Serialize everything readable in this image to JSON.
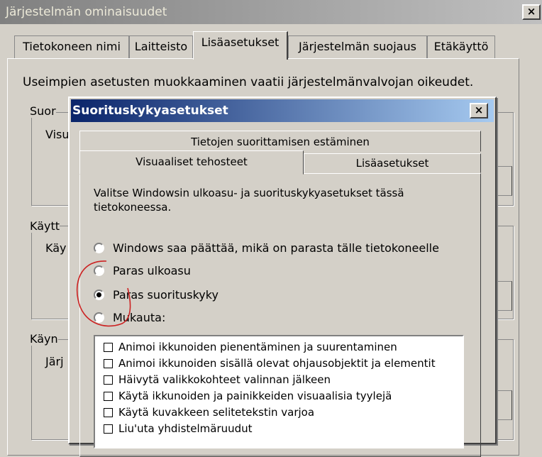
{
  "outer_window": {
    "title": "Järjestelmän ominaisuudet",
    "close_label": "×",
    "tabs": [
      {
        "label": "Tietokoneen nimi"
      },
      {
        "label": "Laitteisto"
      },
      {
        "label": "Lisäasetukset",
        "active": true
      },
      {
        "label": "Järjestelmän suojaus"
      },
      {
        "label": "Etäkäyttö"
      }
    ],
    "admin_note": "Useimpien asetusten muokkaaminen vaatii järjestelmänvalvojan oikeudet.",
    "groups": [
      {
        "label": "Suor",
        "sub": "Visu"
      },
      {
        "label": "Käytt",
        "sub": "Käy"
      },
      {
        "label": "Käyn",
        "sub": "Järj"
      }
    ]
  },
  "inner_dialog": {
    "title": "Suorituskykyasetukset",
    "close_label": "×",
    "tabs": {
      "data_execution": "Tietojen suorittamisen estäminen",
      "visual_effects": "Visuaaliset tehosteet",
      "advanced": "Lisäasetukset"
    },
    "description": "Valitse Windowsin ulkoasu- ja suorituskykyasetukset tässä tietokoneessa.",
    "radio_options": [
      {
        "label": "Windows saa päättää, mikä on parasta tälle tietokoneelle",
        "selected": false
      },
      {
        "label": "Paras ulkoasu",
        "selected": false
      },
      {
        "label": "Paras suorituskyky",
        "selected": true
      },
      {
        "label": "Mukauta:",
        "selected": false
      }
    ],
    "checkbox_options": [
      {
        "label": "Animoi ikkunoiden pienentäminen ja suurentaminen",
        "checked": false
      },
      {
        "label": "Animoi ikkunoiden sisällä olevat ohjausobjektit ja elementit",
        "checked": false
      },
      {
        "label": "Häivytä valikkokohteet valinnan jälkeen",
        "checked": false
      },
      {
        "label": "Käytä ikkunoiden ja painikkeiden visuaalisia tyylejä",
        "checked": false
      },
      {
        "label": "Käytä kuvakkeen selitetekstin varjoa",
        "checked": false
      },
      {
        "label": "Liu'uta yhdistelmäruudut",
        "checked": false
      }
    ]
  },
  "colors": {
    "inner_title_start": "#0a246a",
    "inner_title_end": "#a6caf0",
    "annotation": "#cc2222"
  }
}
